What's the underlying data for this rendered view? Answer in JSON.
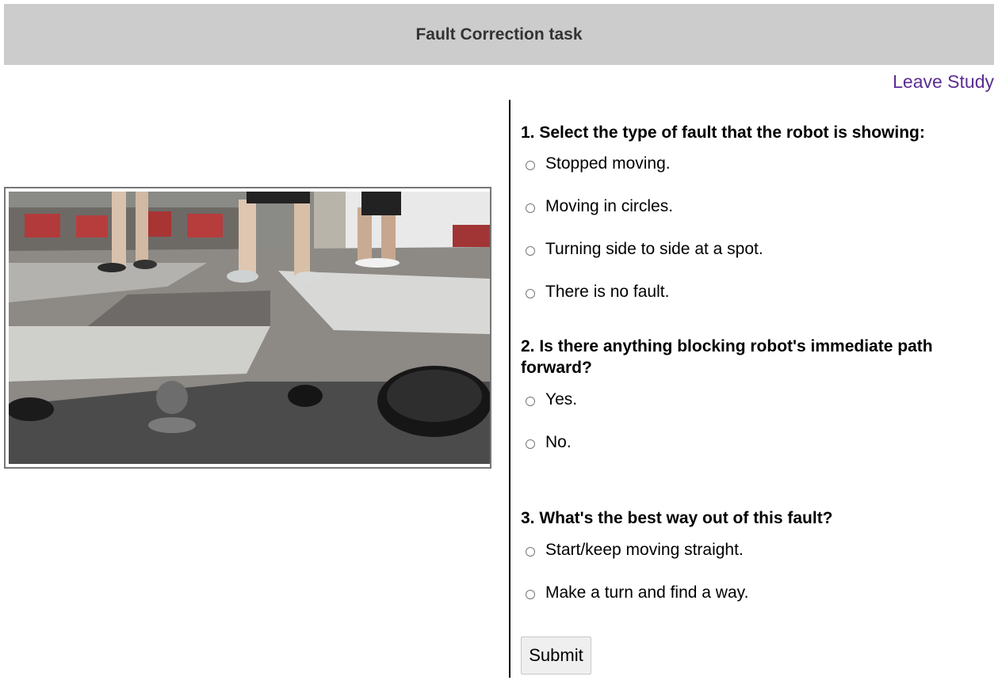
{
  "header": {
    "title": "Fault Correction task"
  },
  "nav": {
    "leave_label": "Leave Study"
  },
  "questions": [
    {
      "title": "1. Select the type of fault that the robot is showing:",
      "options": [
        "Stopped moving.",
        "Moving in circles.",
        "Turning side to side at a spot.",
        "There is no fault."
      ]
    },
    {
      "title": "2. Is there anything blocking robot's immediate path forward?",
      "options": [
        "Yes.",
        "No."
      ]
    },
    {
      "title": "3. What's the best way out of this fault?",
      "options": [
        "Start/keep moving straight.",
        "Make a turn and find a way."
      ]
    }
  ],
  "form": {
    "submit_label": "Submit"
  },
  "video": {
    "icon": "robot-camera-video-frame"
  }
}
